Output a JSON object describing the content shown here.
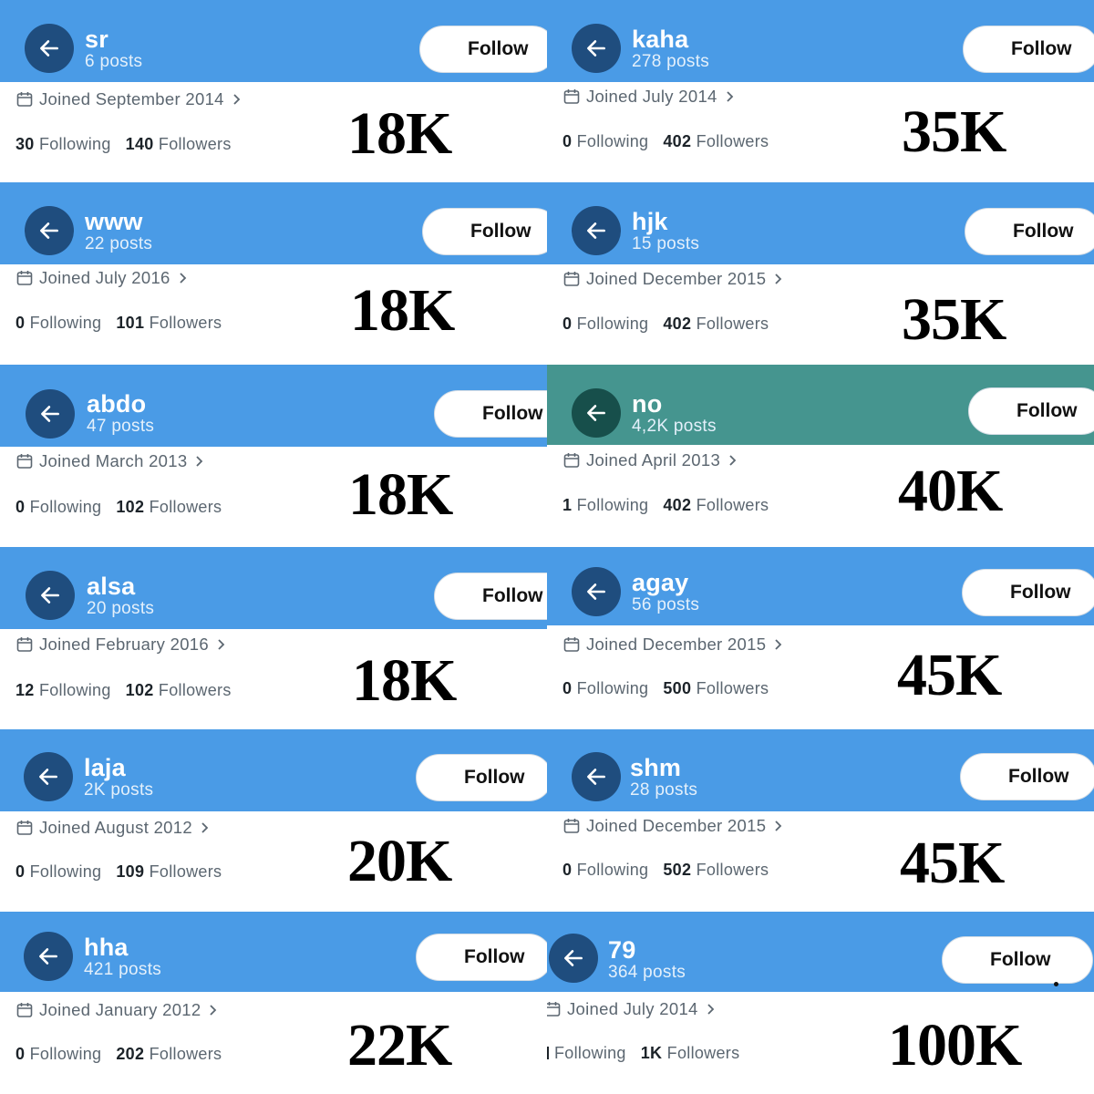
{
  "colors": {
    "banner_blue": "#4a9be6",
    "banner_teal": "#45958f",
    "back_button_blue": "#1f4d7e",
    "back_button_teal": "#174f4b"
  },
  "profiles": [
    {
      "name": "sr",
      "posts": "6 posts",
      "follow": "Follow",
      "joined": "Joined September 2014",
      "following_count": "30",
      "following_label": "Following",
      "followers_count": "140",
      "followers_label": "Followers",
      "price": "18K",
      "banner": "blue"
    },
    {
      "name": "kaha",
      "posts": "278 posts",
      "follow": "Follow",
      "joined": "Joined July 2014",
      "following_count": "0",
      "following_label": "Following",
      "followers_count": "402",
      "followers_label": "Followers",
      "price": "35K",
      "banner": "blue"
    },
    {
      "name": "www",
      "posts": "22 posts",
      "follow": "Follow",
      "joined": "Joined July 2016",
      "following_count": "0",
      "following_label": "Following",
      "followers_count": "101",
      "followers_label": "Followers",
      "price": "18K",
      "banner": "blue"
    },
    {
      "name": "hjk",
      "posts": "15 posts",
      "follow": "Follow",
      "joined": "Joined December 2015",
      "following_count": "0",
      "following_label": "Following",
      "followers_count": "402",
      "followers_label": "Followers",
      "price": "35K",
      "banner": "blue"
    },
    {
      "name": "abdo",
      "posts": "47 posts",
      "follow": "Follow",
      "joined": "Joined March 2013",
      "following_count": "0",
      "following_label": "Following",
      "followers_count": "102",
      "followers_label": "Followers",
      "price": "18K",
      "banner": "blue"
    },
    {
      "name": "no",
      "posts": "4,2K posts",
      "follow": "Follow",
      "joined": "Joined April 2013",
      "following_count": "1",
      "following_label": "Following",
      "followers_count": "402",
      "followers_label": "Followers",
      "price": "40K",
      "banner": "teal"
    },
    {
      "name": "alsa",
      "posts": "20 posts",
      "follow": "Follow",
      "joined": "Joined February 2016",
      "following_count": "12",
      "following_label": "Following",
      "followers_count": "102",
      "followers_label": "Followers",
      "price": "18K",
      "banner": "blue"
    },
    {
      "name": "agay",
      "posts": "56 posts",
      "follow": "Follow",
      "joined": "Joined December 2015",
      "following_count": "0",
      "following_label": "Following",
      "followers_count": "500",
      "followers_label": "Followers",
      "price": "45K",
      "banner": "blue"
    },
    {
      "name": "laja",
      "posts": "2K posts",
      "follow": "Follow",
      "joined": "Joined August 2012",
      "following_count": "0",
      "following_label": "Following",
      "followers_count": "109",
      "followers_label": "Followers",
      "price": "20K",
      "banner": "blue"
    },
    {
      "name": "shm",
      "posts": "28 posts",
      "follow": "Follow",
      "joined": "Joined December 2015",
      "following_count": "0",
      "following_label": "Following",
      "followers_count": "502",
      "followers_label": "Followers",
      "price": "45K",
      "banner": "blue"
    },
    {
      "name": "hha",
      "posts": "421 posts",
      "follow": "Follow",
      "joined": "Joined January 2012",
      "following_count": "0",
      "following_label": "Following",
      "followers_count": "202",
      "followers_label": "Followers",
      "price": "22K",
      "banner": "blue"
    },
    {
      "name": "79",
      "posts": "364 posts",
      "follow": "Follow",
      "joined": "Joined July 2014",
      "following_count": "",
      "following_label": "Following",
      "followers_count": "1K",
      "followers_label": "Followers",
      "price": "100K",
      "banner": "blue"
    }
  ]
}
